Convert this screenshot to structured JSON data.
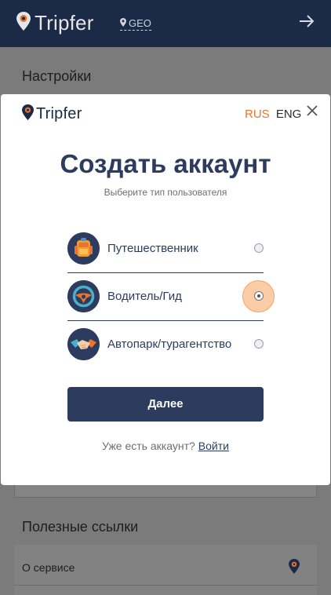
{
  "header": {
    "brand": "Tripfer",
    "geo_label": "GEO",
    "icons": [
      "location-pin-icon",
      "map-pin-icon",
      "arrow-right-icon"
    ]
  },
  "background": {
    "settings_title": "Настройки",
    "links_title": "Полезные ссылки",
    "links": [
      {
        "label": "О сервисе",
        "icon": "tripfer-pin-icon"
      }
    ]
  },
  "modal": {
    "brand": "Tripfer",
    "lang": {
      "rus": "RUS",
      "eng": "ENG",
      "active": "RUS"
    },
    "close_icon": "close-icon",
    "title": "Создать аккаунт",
    "subtitle": "Выберите тип пользователя",
    "options": [
      {
        "label": "Путешественник",
        "icon": "backpack-icon",
        "selected": false
      },
      {
        "label": "Водитель/Гид",
        "icon": "steering-wheel-icon",
        "selected": true
      },
      {
        "label": "Автопарк/турагентство",
        "icon": "handshake-icon",
        "selected": false
      }
    ],
    "next_button": "Далее",
    "login_prompt": "Уже есть аккаунт?",
    "login_link": "Войти"
  },
  "colors": {
    "brand_navy": "#1b2a47",
    "primary": "#2d3c5e",
    "accent_orange": "#e8742f"
  }
}
